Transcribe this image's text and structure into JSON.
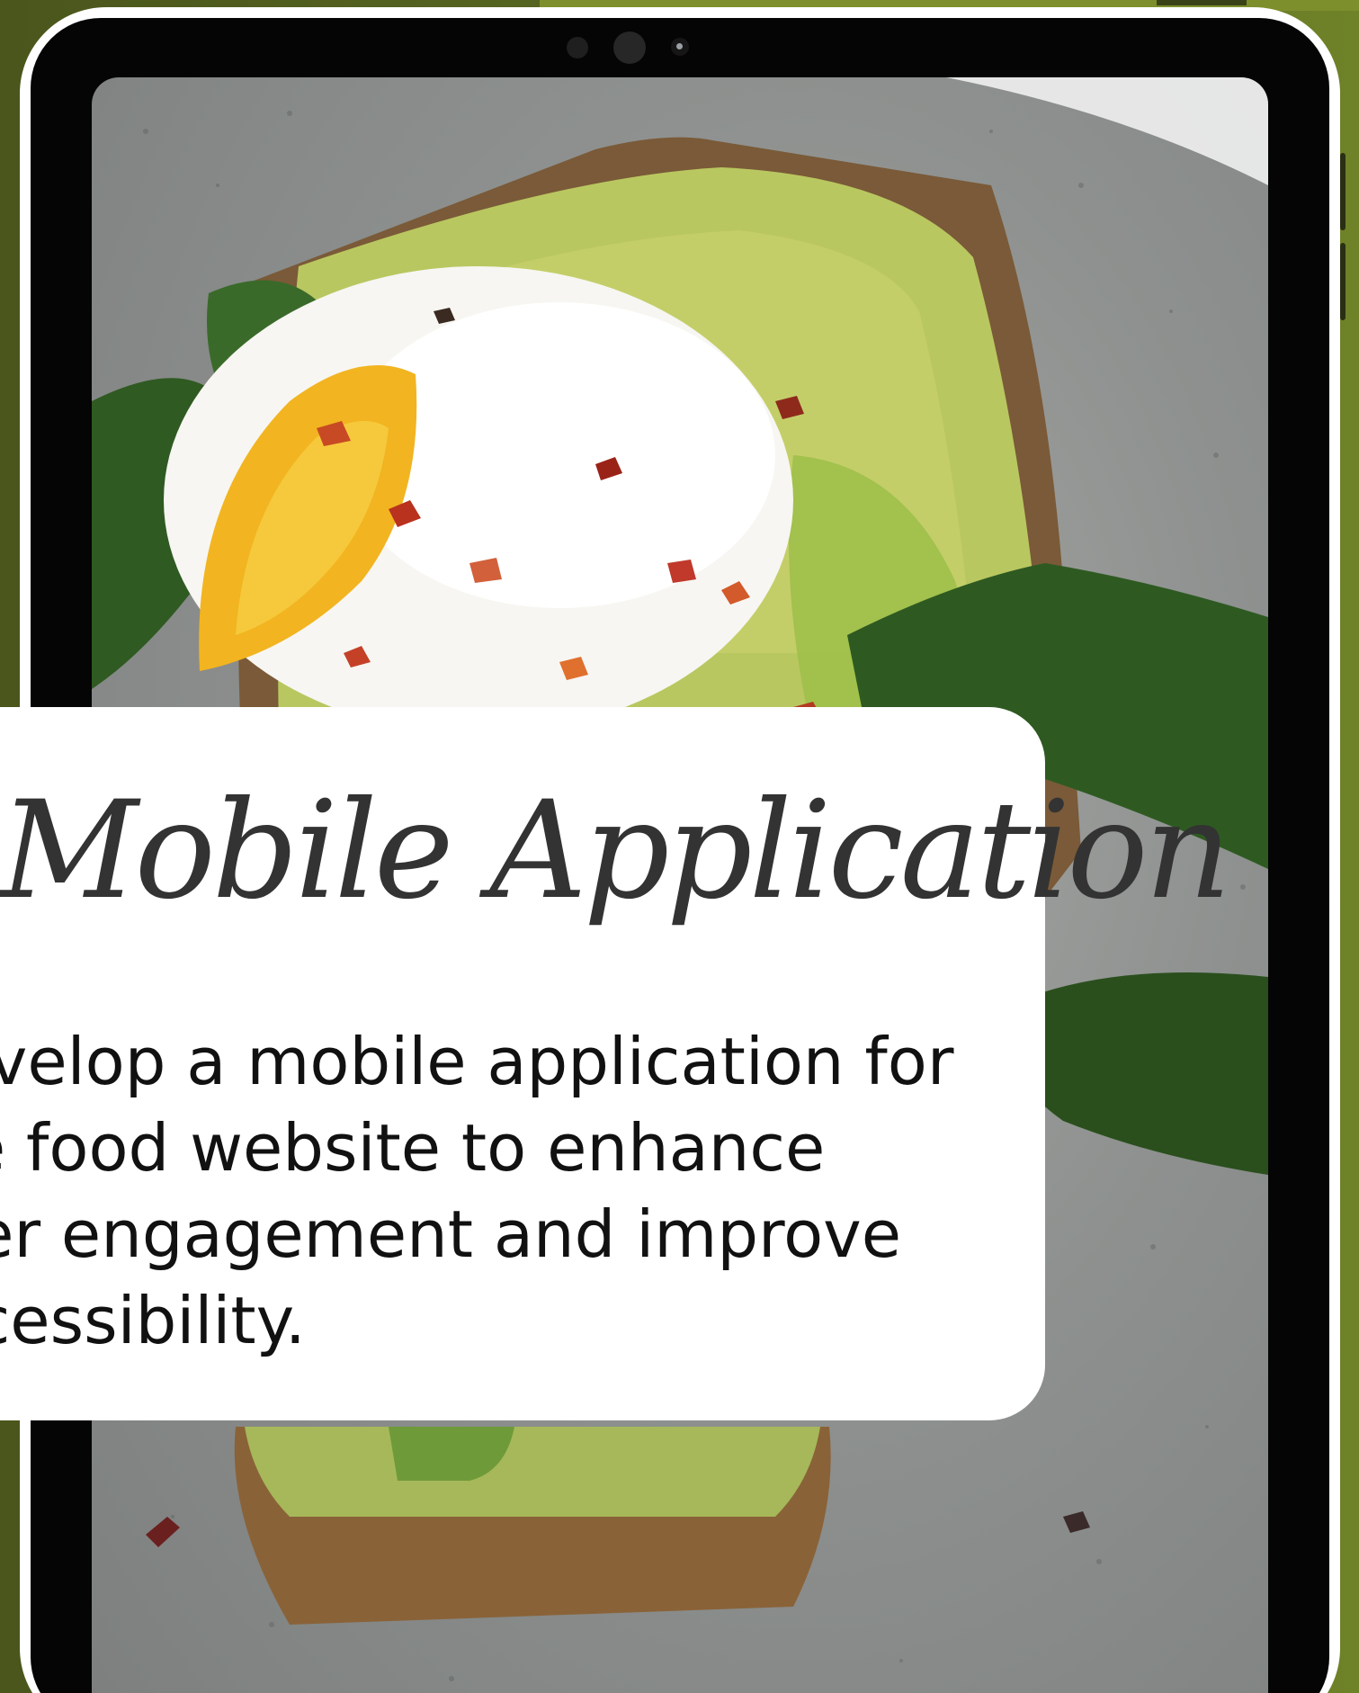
{
  "hero": {
    "title": "Mobile Application",
    "description": "Develop a mobile application for the food website to enhance user engagement and improve accessibility."
  },
  "photo": {
    "subject-icon": "avocado-toast-photo"
  },
  "colors": {
    "background": "#5a6a23",
    "bezel": "#050505",
    "frame": "#ffffff",
    "card": "#ffffff",
    "title_text": "#333333",
    "body_text": "#111111"
  }
}
